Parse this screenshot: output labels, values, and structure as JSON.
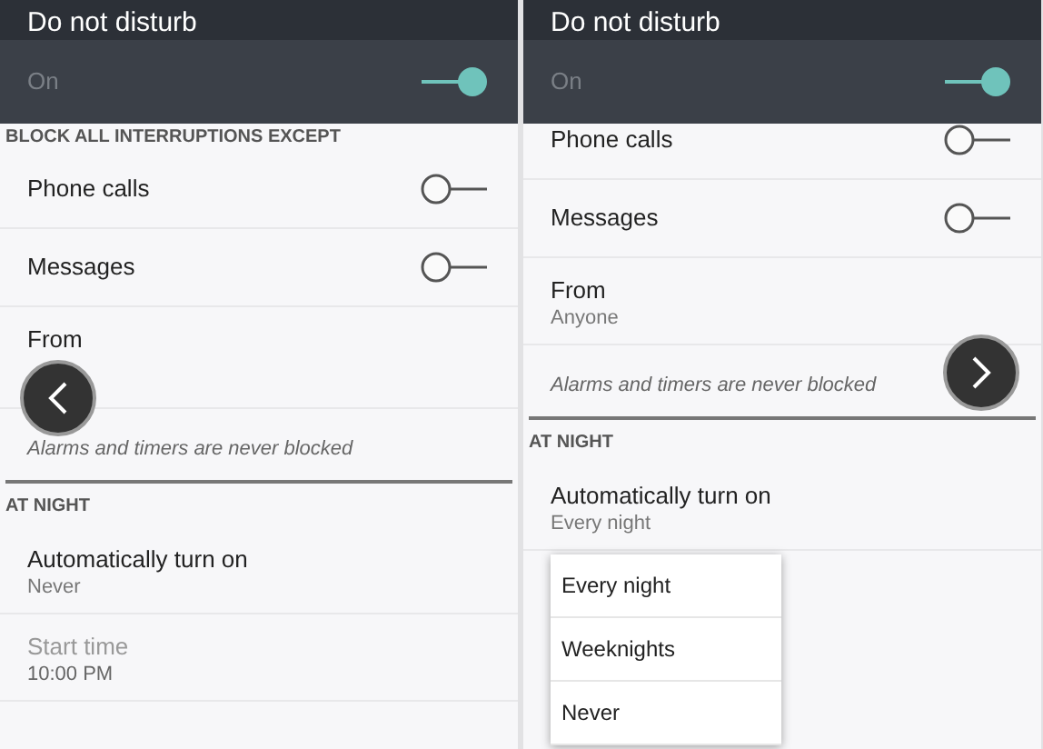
{
  "screens": [
    {
      "header": {
        "title": "Do not disturb",
        "label": "On",
        "on": true
      },
      "scrolled": false,
      "nav": {
        "kind": "previous"
      },
      "sections": [
        {
          "heading": "BLOCK ALL INTERRUPTIONS EXCEPT",
          "items": [
            {
              "kind": "switch",
              "title": "Phone calls",
              "on": false
            },
            {
              "kind": "switch",
              "title": "Messages",
              "on": false
            },
            {
              "kind": "value",
              "title": "From",
              "disabled": false
            },
            {
              "kind": "note",
              "title": "Alarms and timers are never blocked"
            }
          ]
        },
        {
          "heading": "AT NIGHT",
          "items": [
            {
              "kind": "value",
              "title": "Automatically turn on",
              "value": "Never",
              "disabled": false
            },
            {
              "kind": "value",
              "title": "Start time",
              "value": "10:00 PM",
              "disabled": true
            }
          ]
        }
      ]
    },
    {
      "header": {
        "title": "Do not disturb",
        "label": "On",
        "on": true
      },
      "scrolled": true,
      "nav": {
        "kind": "next"
      },
      "sections": [
        {
          "items": [
            {
              "kind": "switch",
              "title": "Phone calls",
              "on": false
            },
            {
              "kind": "switch",
              "title": "Messages",
              "on": false
            },
            {
              "kind": "value",
              "title": "From",
              "value": "Anyone",
              "disabled": false
            },
            {
              "kind": "note",
              "title": "Alarms and timers are never blocked"
            }
          ]
        },
        {
          "heading": "AT NIGHT",
          "items": [
            {
              "kind": "value",
              "title": "Automatically turn on",
              "value": "Every night",
              "disabled": false
            }
          ]
        }
      ],
      "menu": {
        "items": [
          "Every night",
          "Weeknights",
          "Never"
        ]
      }
    }
  ]
}
